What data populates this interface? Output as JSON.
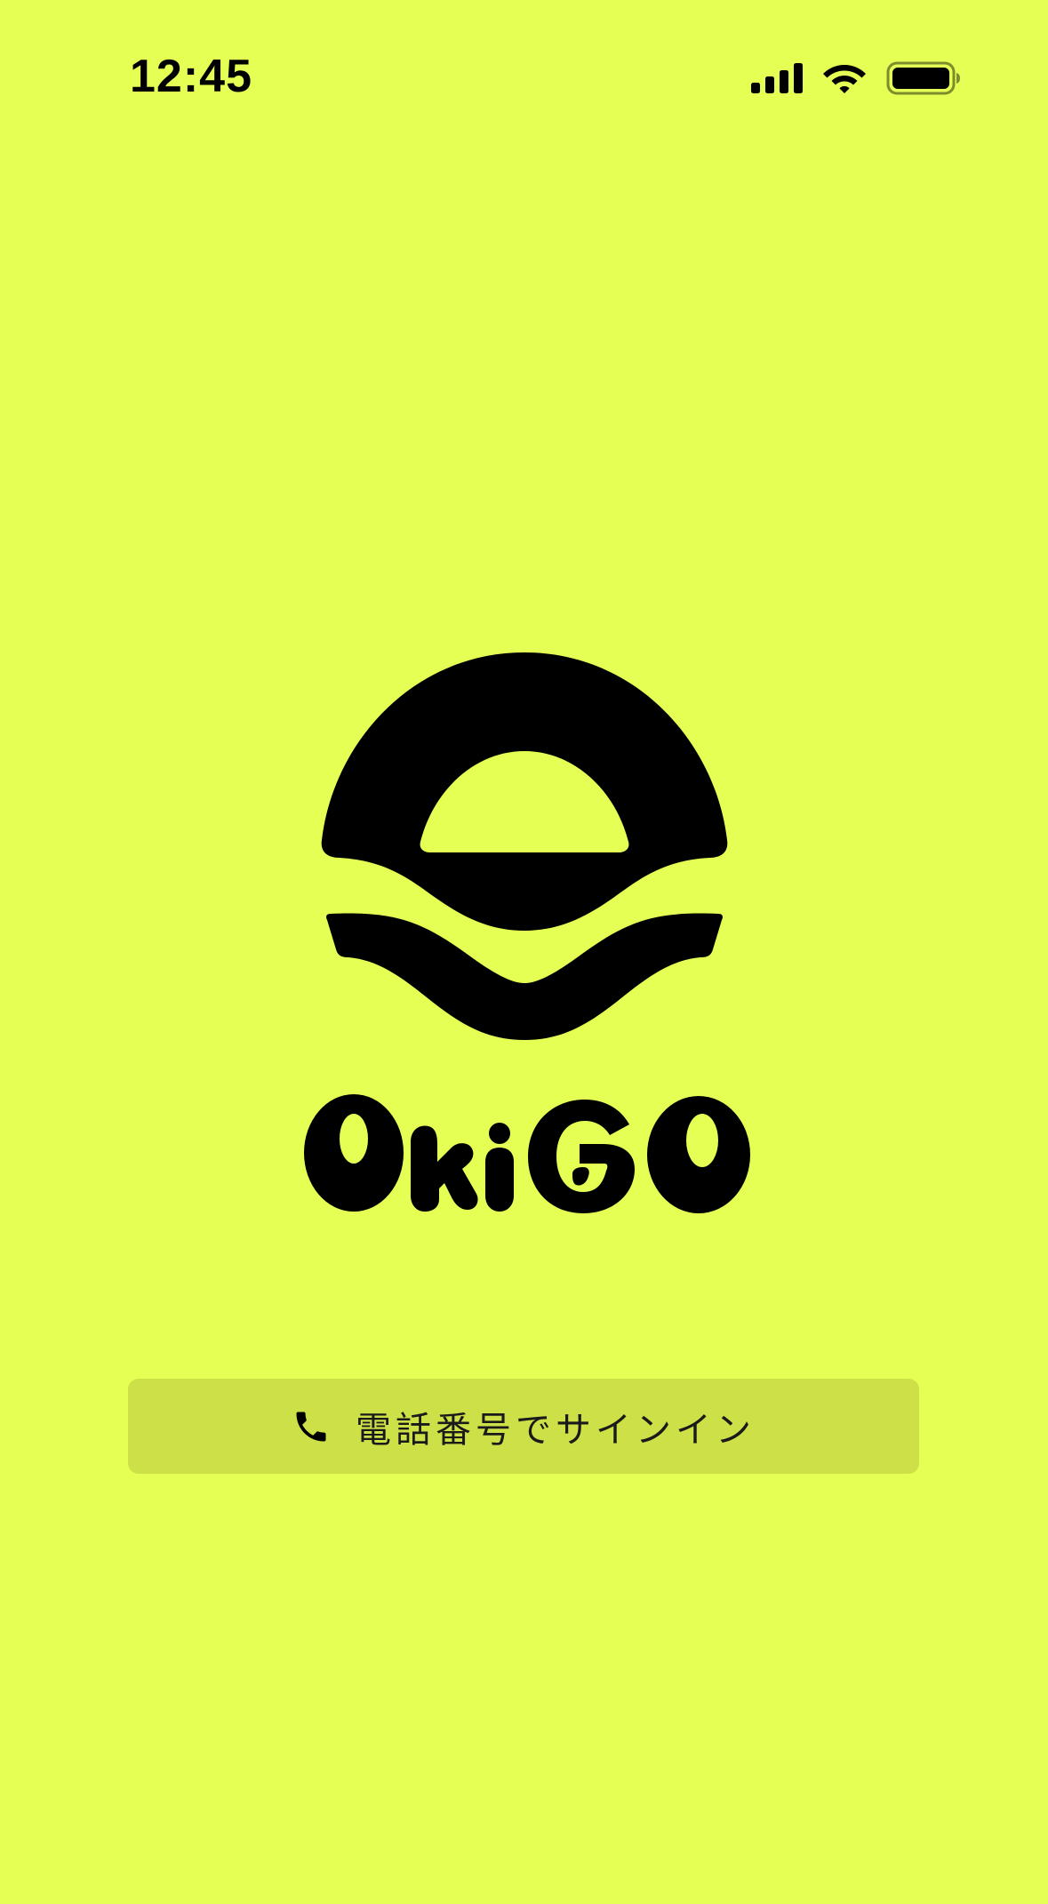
{
  "status_bar": {
    "time": "12:45",
    "icons": [
      "cellular-signal-icon",
      "wifi-icon",
      "battery-icon"
    ]
  },
  "brand": {
    "name": "OKiGO",
    "logo_icon": "sun-over-waves-logo"
  },
  "signin": {
    "icon": "phone-icon",
    "label": "電話番号でサインイン"
  },
  "colors": {
    "background": "#e6ff54",
    "button_background": "#cde047",
    "foreground": "#000000"
  }
}
